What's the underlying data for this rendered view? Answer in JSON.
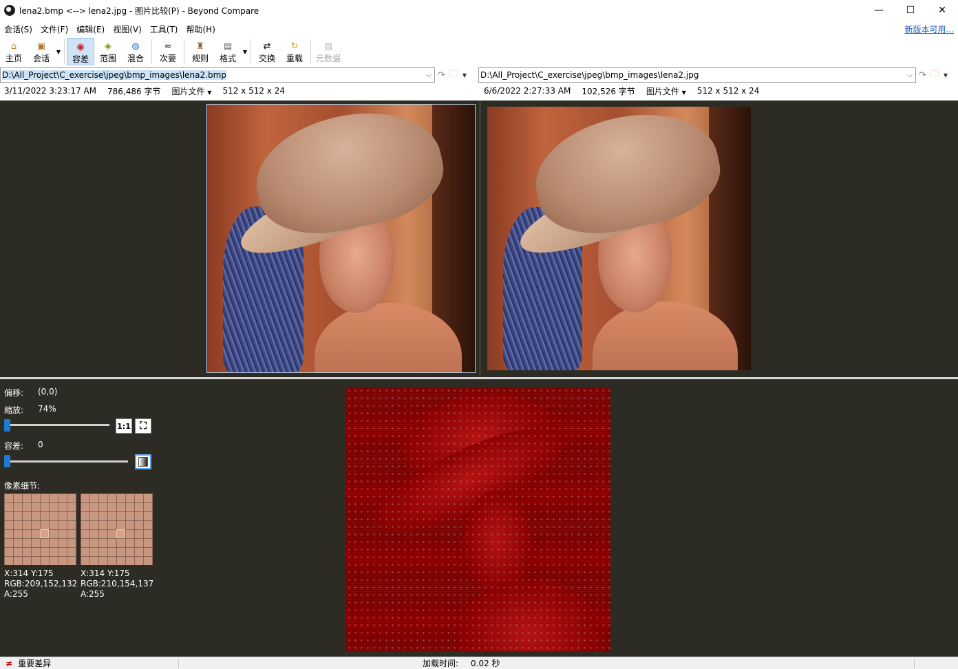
{
  "window": {
    "title": "lena2.bmp <--> lena2.jpg - 图片比较(P) - Beyond Compare",
    "minimize": "—",
    "maximize": "☐",
    "close": "✕"
  },
  "menu": {
    "items": [
      "会话(S)",
      "文件(F)",
      "编辑(E)",
      "视图(V)",
      "工具(T)",
      "帮助(H)"
    ],
    "new_version": "新版本可用..."
  },
  "toolbar": {
    "home": "主页",
    "session": "会话",
    "tolerance": "容差",
    "range": "范围",
    "blend": "混合",
    "minor": "次要",
    "rules": "规则",
    "format": "格式",
    "swap": "交换",
    "reload": "重载",
    "metadata": "元数据"
  },
  "left": {
    "path": "D:\\All_Project\\C_exercise\\jpeg\\bmp_images\\lena2.bmp",
    "date": "3/11/2022 3:23:17 AM",
    "size": "786,486 字节",
    "type": "图片文件",
    "dims": "512 x 512 x 24"
  },
  "right": {
    "path": "D:\\All_Project\\C_exercise\\jpeg\\bmp_images\\lena2.jpg",
    "date": "6/6/2022 2:27:33 AM",
    "size": "102,526 字节",
    "type": "图片文件",
    "dims": "512 x 512 x 24"
  },
  "controls": {
    "offset_label": "偏移:",
    "offset_value": "(0,0)",
    "zoom_label": "缩放:",
    "zoom_value": "74%",
    "zoom_1to1": "1:1",
    "tolerance_label": "容差:",
    "tolerance_value": "0",
    "pixel_detail_label": "像素细节:",
    "zoom_level": 0.0,
    "tolerance_level": 0.0
  },
  "pixel_left": {
    "xy": "X:314 Y:175",
    "rgb": "RGB:209,152,132",
    "alpha": "A:255"
  },
  "pixel_right": {
    "xy": "X:314 Y:175",
    "rgb": "RGB:210,154,137",
    "alpha": "A:255"
  },
  "status": {
    "diff_symbol": "≠",
    "diff_label": "重要差异",
    "load_time_label": "加载时间:",
    "load_time_value": "0.02 秒"
  },
  "colors": {
    "panel_bg": "#2c2c24",
    "diff_red": "#8a0000",
    "accent": "#1e78d6",
    "link": "#1f5fbf"
  }
}
